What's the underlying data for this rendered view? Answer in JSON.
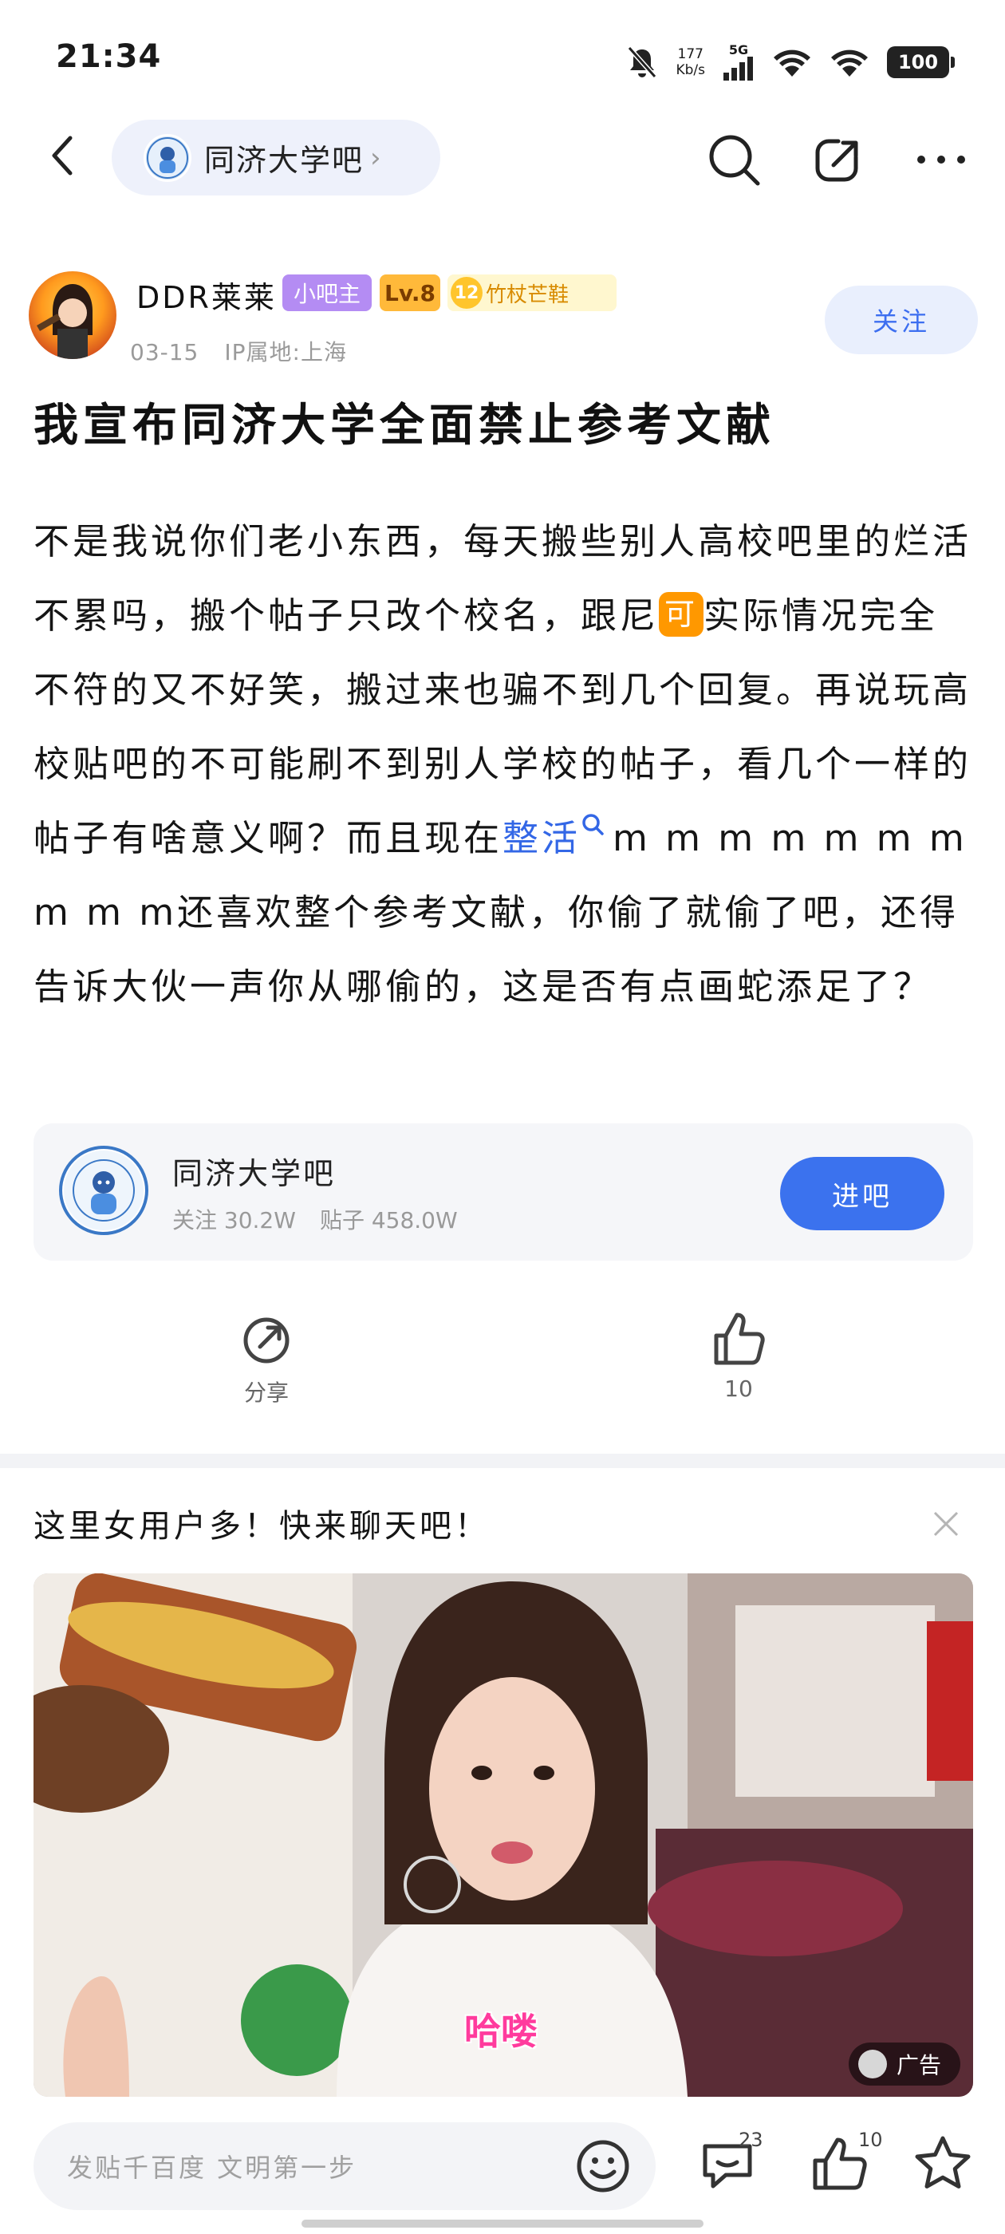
{
  "status_bar": {
    "time": "21:34",
    "net_speed_value": "177",
    "net_speed_unit": "Kb/s",
    "signal_tag": "5G",
    "battery": "100"
  },
  "nav": {
    "forum_name": "同济大学吧",
    "chevron": "›"
  },
  "author": {
    "name": "DDR莱莱",
    "role_badge": "小吧主",
    "level_badge": "Lv.8",
    "title_medal": "12",
    "title_badge": "竹杖芒鞋",
    "date": "03-15",
    "ip_location": "IP属地:上海",
    "follow_label": "关注"
  },
  "post": {
    "title": "我宣布同济大学全面禁止参考文献",
    "body_part1": "不是我说你们老小东西，每天搬些别人高校吧里的烂活不累吗，搬个帖子只改个校名，跟尼",
    "inline_emoji": "可",
    "body_part2": "实际情况完全不符的又不好笑，搬过来也骗不到几个回复。再说玩高校贴吧的不可能刷不到别人学校的帖子，看几个一样的帖子有啥意义啊？而且现在",
    "link_text": "整活",
    "body_part3": "m m m m m m m m m m还喜欢整个参考文献，你偷了就偷了吧，还得告诉大伙一声你从哪偷的，这是否有点画蛇添足了？"
  },
  "forum_card": {
    "name": "同济大学吧",
    "followers": "关注 30.2W",
    "posts": "贴子 458.0W",
    "enter_label": "进吧"
  },
  "actions": {
    "share_label": "分享",
    "like_count": "10"
  },
  "ad": {
    "title": "这里女用户多！快来聊天吧！",
    "caption": "哈喽",
    "badge": "广告"
  },
  "bottom_bar": {
    "input_placeholder": "发贴千百度 文明第一步",
    "comment_count": "23",
    "like_count": "10"
  },
  "colors": {
    "accent_blue": "#3B72EE",
    "follow_bg": "#E9EFFD",
    "mod_badge": "#B48CF3",
    "level_badge": "#FFB93A",
    "emoji_orange": "#FF9800"
  },
  "icons": [
    "back-arrow-icon",
    "chevron-right-icon",
    "search-icon",
    "share-icon",
    "more-icon",
    "share-icon",
    "thumbs-up-icon",
    "close-icon",
    "emoji-icon",
    "comment-icon",
    "thumbs-up-icon",
    "star-icon"
  ]
}
